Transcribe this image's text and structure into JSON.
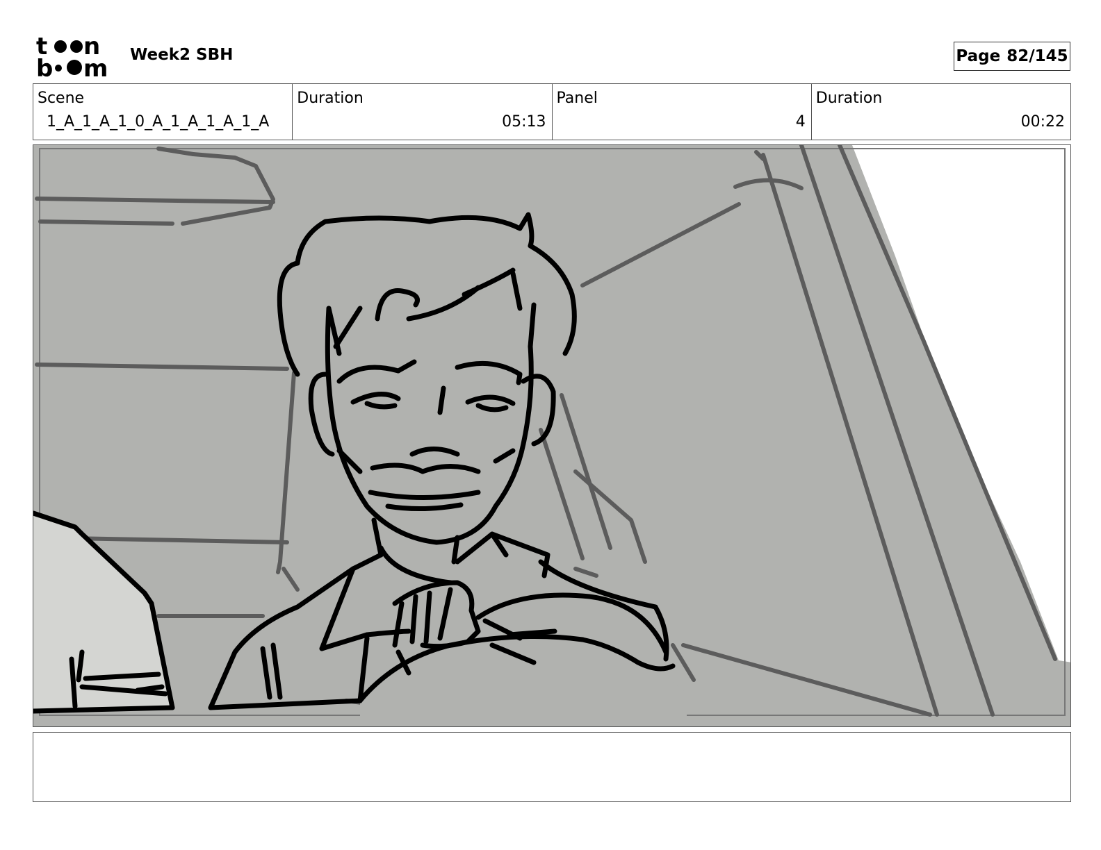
{
  "header": {
    "logo_text_line1": "toon",
    "logo_text_line2": "boom",
    "project_title": "Week2 SBH",
    "page_label": "Page",
    "page_number": "82/145"
  },
  "info": {
    "scene_label": "Scene",
    "scene_value": "1_A_1_A_1_0_A_1_A_1_A_1_A",
    "scene_duration_label": "Duration",
    "scene_duration_value": "05:13",
    "panel_label": "Panel",
    "panel_value": "4",
    "panel_duration_label": "Duration",
    "panel_duration_value": "00:22"
  },
  "panel": {
    "image_description": "storyboard-sketch-man-driving-car",
    "background_color": "#b1b2af",
    "window_color": "#ffffff",
    "seat_color": "#d4d5d2"
  },
  "notes": {
    "text": ""
  }
}
